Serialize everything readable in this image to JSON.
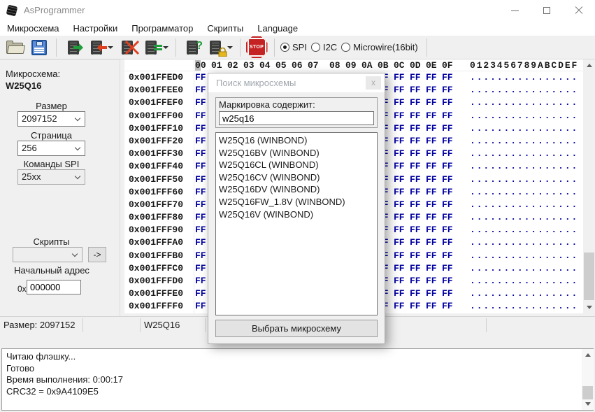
{
  "window": {
    "title": "AsProgrammer"
  },
  "menu": {
    "items": [
      "Микросхема",
      "Настройки",
      "Программатор",
      "Скрипты",
      "Language"
    ]
  },
  "toolbar": {
    "stop_label": "STOP",
    "interfaces": {
      "options": [
        "SPI",
        "I2C",
        "Microwire(16bit)"
      ],
      "selected": "SPI"
    },
    "icons": [
      "open-file-icon",
      "save-file-icon",
      "write-chip-icon",
      "read-chip-icon",
      "erase-chip-icon",
      "verify-chip-icon",
      "identify-chip-icon",
      "unlock-chip-icon",
      "stop-icon"
    ]
  },
  "sidebar": {
    "chip_label": "Микросхема:",
    "chip_name": "W25Q16",
    "size_label": "Размер",
    "size_value": "2097152",
    "page_label": "Страница",
    "page_value": "256",
    "spi_commands_label": "Команды SPI",
    "spi_commands_value": "25xx",
    "scripts_label": "Скрипты",
    "scripts_value": "",
    "run_script_label": "->",
    "start_address_label": "Начальный адрес",
    "hex_prefix": "0x",
    "start_address_value": "000000"
  },
  "hex_view": {
    "header_bytes": [
      "00",
      "01",
      "02",
      "03",
      "04",
      "05",
      "06",
      "07",
      "08",
      "09",
      "0A",
      "0B",
      "0C",
      "0D",
      "0E",
      "0F"
    ],
    "ascii_header": "0123456789ABCDEF",
    "byte_value": "FF",
    "ascii_char": ".",
    "addresses": [
      "0x001FFED0",
      "0x001FFEE0",
      "0x001FFEF0",
      "0x001FFF00",
      "0x001FFF10",
      "0x001FFF20",
      "0x001FFF30",
      "0x001FFF40",
      "0x001FFF50",
      "0x001FFF60",
      "0x001FFF70",
      "0x001FFF80",
      "0x001FFF90",
      "0x001FFFA0",
      "0x001FFFB0",
      "0x001FFFC0",
      "0x001FFFD0",
      "0x001FFFE0",
      "0x001FFFF0"
    ]
  },
  "dialog": {
    "title": "Поиск микросхемы",
    "close_label": "x",
    "filter_label": "Маркировка содержит:",
    "filter_value": "w25q16",
    "chips": [
      "W25Q16 (WINBOND)",
      "W25Q16BV (WINBOND)",
      "W25Q16CL (WINBOND)",
      "W25Q16CV (WINBOND)",
      "W25Q16DV (WINBOND)",
      "W25Q16FW_1.8V (WINBOND)",
      "W25Q16V (WINBOND)"
    ],
    "select_button": "Выбрать микросхему"
  },
  "status_bar": {
    "size": "Размер: 2097152",
    "chip": "W25Q16"
  },
  "log": {
    "lines": [
      "Читаю флэшку...",
      "Готово",
      "Время выполнения: 0:00:17",
      "CRC32 = 0x9A4109E5"
    ]
  },
  "colors": {
    "hex_byte": "#0000a0",
    "stop_red": "#c52323",
    "arrow_green": "#1f9d3a",
    "arrow_red": "#e0401f",
    "lock_yellow": "#e6b61e",
    "accent_window": "#ffffff"
  }
}
